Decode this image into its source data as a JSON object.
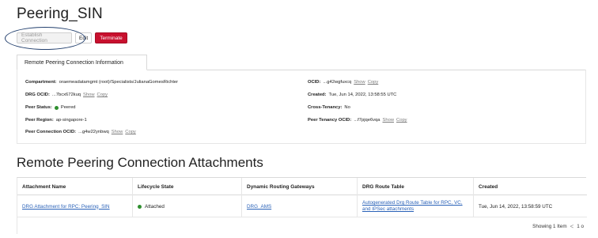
{
  "page": {
    "title": "Peering_SIN"
  },
  "actions": {
    "establish_label": "Establish Connection",
    "edit_label": "Edit",
    "terminate_label": "Terminate"
  },
  "tabs": [
    {
      "label": "Remote Peering Connection Information"
    }
  ],
  "info": {
    "compartment": {
      "key": "Compartment:",
      "value": "oraemeadatamgmt (root)/Specialists/JulianaGomesRichter"
    },
    "drg_ocid": {
      "key": "DRG OCID:",
      "value": "...7bcx672kuq",
      "show": "Show",
      "copy": "Copy"
    },
    "peer_status": {
      "key": "Peer Status:",
      "value": "Peered",
      "status_color": "#2f8f2f"
    },
    "peer_region": {
      "key": "Peer Region:",
      "value": "ap-singapore-1"
    },
    "peer_connection_ocid": {
      "key": "Peer Connection OCID:",
      "value": "...g4w22ynbwq",
      "show": "Show",
      "copy": "Copy"
    },
    "ocid": {
      "key": "OCID:",
      "value": "...g42wgfuxcq",
      "show": "Show",
      "copy": "Copy"
    },
    "created": {
      "key": "Created:",
      "value": "Tue, Jun 14, 2022, 13:58:55 UTC"
    },
    "cross_tenancy": {
      "key": "Cross-Tenancy:",
      "value": "No"
    },
    "peer_tenancy_ocid": {
      "key": "Peer Tenancy OCID:",
      "value": "...f7pjqe6vqa",
      "show": "Show",
      "copy": "Copy"
    }
  },
  "attachments": {
    "section_title": "Remote Peering Connection Attachments",
    "columns": [
      "Attachment Name",
      "Lifecycle State",
      "Dynamic Routing Gateways",
      "DRG Route Table",
      "Created"
    ],
    "rows": [
      {
        "name": "DRG Attachment for RPC: Peering_SIN",
        "state": "Attached",
        "drg": "DRG_AMS",
        "route_table": "Autogenerated Drg Route Table for RPC, VC, and IPSec attachments",
        "created": "Tue, Jun 14, 2022, 13:58:59 UTC"
      }
    ],
    "footer": {
      "showing": "Showing 1 Item",
      "page_prev": "<",
      "page_text": "1 o"
    }
  },
  "colors": {
    "terminate": "#c8102e",
    "link": "#2a62b8",
    "status_green": "#2f8f2f",
    "annotation": "#23406e"
  }
}
